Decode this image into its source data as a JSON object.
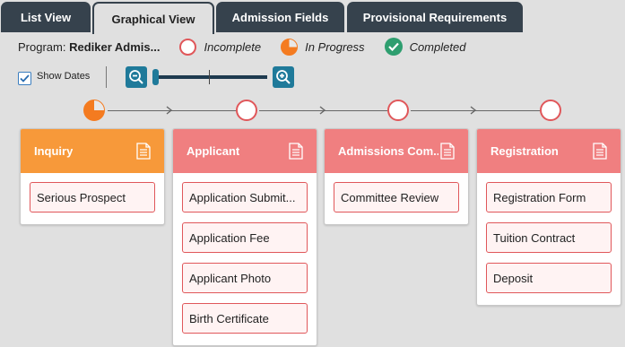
{
  "tabs": [
    {
      "label": "List View"
    },
    {
      "label": "Graphical View"
    },
    {
      "label": "Admission Fields"
    },
    {
      "label": "Provisional Requirements"
    }
  ],
  "legend": {
    "program_label": "Program:",
    "program_name": "Rediker Admis...",
    "incomplete": "Incomplete",
    "in_progress": "In Progress",
    "completed": "Completed"
  },
  "controls": {
    "show_dates_label": "Show Dates",
    "show_dates_checked": true,
    "zoom_level": 0
  },
  "colors": {
    "tab_dark": "#36424d",
    "inquiry_header": "#f7993a",
    "stage_header": "#f07f80",
    "item_border": "#e0575a",
    "completed_green": "#2e9e6f",
    "in_progress_orange": "#f47b20",
    "zoom_blue": "#1f7a9a"
  },
  "stages": [
    {
      "title": "Inquiry",
      "status": "in-progress",
      "items": [
        "Serious Prospect"
      ]
    },
    {
      "title": "Applicant",
      "status": "incomplete",
      "items": [
        "Application Submit...",
        "Application Fee",
        "Applicant Photo",
        "Birth Certificate"
      ]
    },
    {
      "title": "Admissions Com...",
      "status": "incomplete",
      "items": [
        "Committee Review"
      ]
    },
    {
      "title": "Registration",
      "status": "incomplete",
      "items": [
        "Registration Form",
        "Tuition Contract",
        "Deposit"
      ]
    }
  ]
}
